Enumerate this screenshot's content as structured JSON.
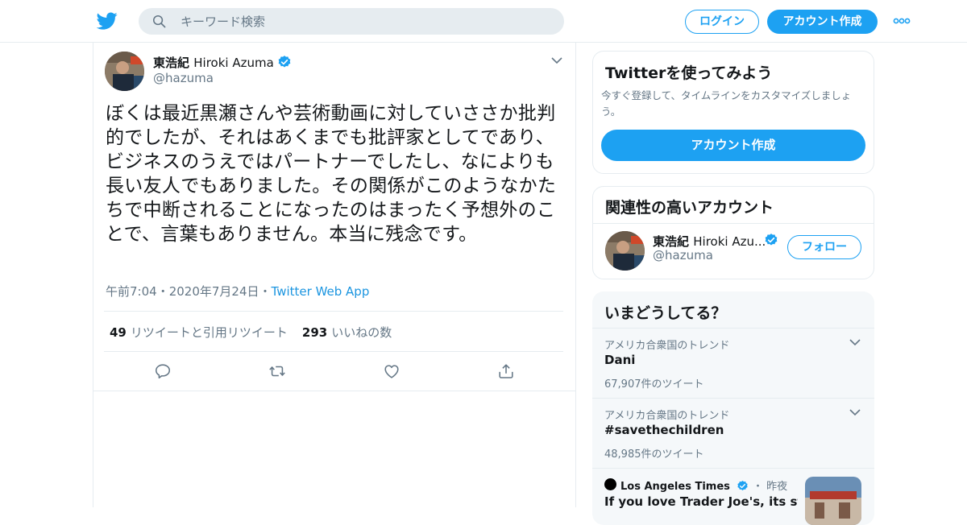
{
  "header": {
    "search_placeholder": "キーワード検索",
    "login_label": "ログイン",
    "signup_label": "アカウント作成"
  },
  "tweet": {
    "author_name_jp": "東浩紀",
    "author_name_en": "Hiroki Azuma",
    "handle": "@hazuma",
    "text": "ぼくは最近黒瀬さんや芸術動画に対していささか批判的でしたが、それはあくまでも批評家としてであり、ビジネスのうえではパートナーでしたし、なによりも長い友人でもありました。その関係がこのようなかたちで中断されることになったのはまったく予想外のことで、言葉もありません。本当に残念です。",
    "time": "午前7:04",
    "date": "2020年7月24日",
    "separator": "・",
    "source": "Twitter Web App",
    "retweets_count": "49",
    "retweets_label": "リツイートと引用リツイート",
    "likes_count": "293",
    "likes_label": "いいねの数"
  },
  "sidebar": {
    "signup_card": {
      "title": "Twitterを使ってみよう",
      "subtitle": "今すぐ登録して、タイムラインをカスタマイズしましょう。",
      "button": "アカウント作成"
    },
    "related_card": {
      "title": "関連性の高いアカウント",
      "account_name_jp": "東浩紀",
      "account_name_en": "Hiroki Azu...",
      "account_handle": "@hazuma",
      "follow_label": "フォロー"
    },
    "trends_card": {
      "title": "いまどうしてる？",
      "items": [
        {
          "context": "アメリカ合衆国のトレンド",
          "name": "Dani",
          "count": "67,907件のツイート"
        },
        {
          "context": "アメリカ合衆国のトレンド",
          "name": "#savethechildren",
          "count": "48,985件のツイート"
        }
      ],
      "news": {
        "source": "Los Angeles Times",
        "time": "・ 昨夜",
        "title": "If you love Trader Joe's, its stances"
      }
    }
  },
  "colors": {
    "accent": "#1da1f2",
    "link": "#1b95e0",
    "muted": "#657786",
    "border": "#e6ecf0"
  },
  "icons": [
    "twitter-bird-icon",
    "search-icon",
    "more-dots-icon",
    "verified-icon",
    "chevron-down-icon",
    "reply-icon",
    "retweet-icon",
    "like-icon",
    "share-icon"
  ]
}
